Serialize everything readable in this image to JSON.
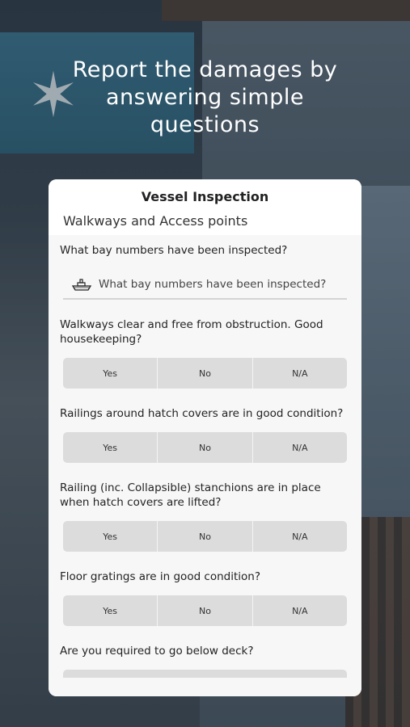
{
  "hero": {
    "line1": "Report the damages by",
    "line2": "answering simple",
    "line3": "questions"
  },
  "card": {
    "title": "Vessel Inspection",
    "subtitle": "Walkways and Access points"
  },
  "questions": [
    {
      "label": "What bay numbers have been inspected?",
      "type": "text",
      "placeholder": "What bay numbers have been inspected?"
    },
    {
      "label": "Walkways clear and free from obstruction. Good housekeeping?",
      "type": "choice",
      "options": [
        "Yes",
        "No",
        "N/A"
      ]
    },
    {
      "label": "Railings around hatch covers are in good condition?",
      "type": "choice",
      "options": [
        "Yes",
        "No",
        "N/A"
      ]
    },
    {
      "label": "Railing (inc. Collapsible) stanchions are in place when hatch covers are lifted?",
      "type": "choice",
      "options": [
        "Yes",
        "No",
        "N/A"
      ]
    },
    {
      "label": "Floor gratings are in good condition?",
      "type": "choice",
      "options": [
        "Yes",
        "No",
        "N/A"
      ]
    },
    {
      "label": "Are you required to go below deck?",
      "type": "choice"
    }
  ],
  "icons": {
    "text_input": "ship-icon",
    "background_logo": "star-logo-icon"
  }
}
